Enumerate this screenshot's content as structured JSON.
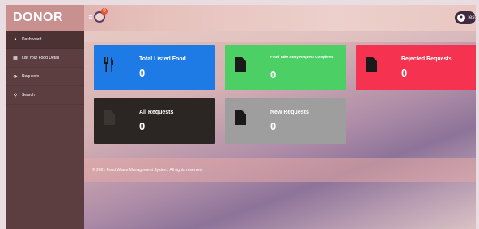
{
  "header": {
    "brand": "DONOR",
    "menu_icon": "hamburger-icon",
    "notification_icon": "bell-icon",
    "notification_count": "0",
    "user_name": "Test"
  },
  "sidebar": {
    "items": [
      {
        "label": "Dashboard",
        "icon": "dashboard-icon",
        "glyph": "▲"
      },
      {
        "label": "List Your Food Detail",
        "icon": "list-icon",
        "glyph": "▦"
      },
      {
        "label": "Requests",
        "icon": "requests-icon",
        "glyph": "⟳"
      },
      {
        "label": "Search",
        "icon": "search-icon",
        "glyph": "⚲"
      }
    ]
  },
  "cards": [
    {
      "label": "Total Listed Food",
      "value": "0",
      "color": "#1e7be5",
      "icon": "utensils-icon"
    },
    {
      "label": "Food Take Away Request Completed",
      "value": "0",
      "color": "#4ccf64",
      "icon": "file-icon"
    },
    {
      "label": "Rejected Requests",
      "value": "0",
      "color": "#f53351",
      "icon": "file-icon"
    },
    {
      "label": "All Requests",
      "value": "0",
      "color": "#2b2624",
      "icon": "file-icon"
    },
    {
      "label": "New Requests",
      "value": "0",
      "color": "#9e9e9e",
      "icon": "file-icon"
    }
  ],
  "footer": {
    "text": "© 2021 Food Waste Management System. All rights reserved."
  }
}
